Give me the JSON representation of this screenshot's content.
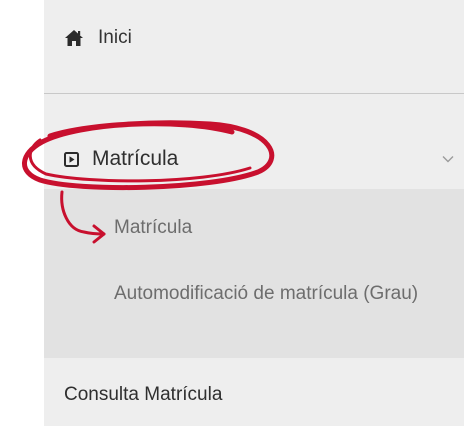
{
  "menu": {
    "home": {
      "label": "Inici",
      "icon": "home-icon"
    },
    "matricula": {
      "label": "Matrícula",
      "icon": "play-square-icon",
      "expanded": true,
      "expand_icon": "chevron-down-icon",
      "subitems": [
        {
          "label": "Matrícula"
        },
        {
          "label": "Automodificació de matrícula (Grau)"
        }
      ]
    },
    "consulta": {
      "label": "Consulta Matrícula"
    }
  },
  "annotation": {
    "color": "#c8102e",
    "shape": "hand-drawn-circle-with-arrow"
  }
}
